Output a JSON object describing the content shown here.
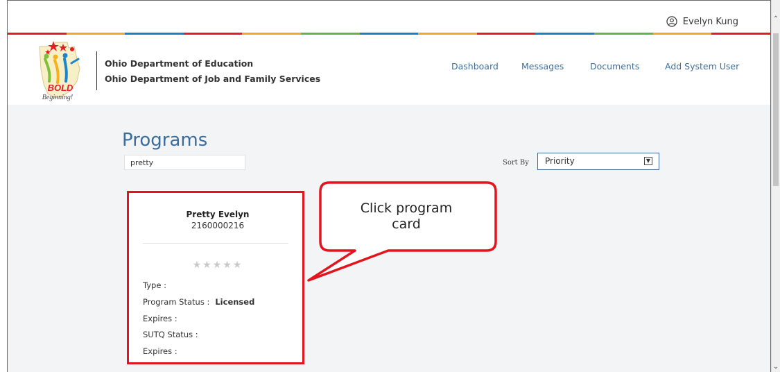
{
  "user": {
    "name": "Evelyn Kung",
    "icon": "user-circle-icon"
  },
  "stripe_colors": [
    "#e31b23",
    "#f5a623",
    "#1b7fc4",
    "#e31b23",
    "#f5a623",
    "#66b245",
    "#1b7fc4",
    "#f5a623",
    "#e31b23",
    "#1b7fc4",
    "#66b245",
    "#f5a623",
    "#e31b23"
  ],
  "brand": {
    "logo_text": "BOLD",
    "logo_subtext": "Beginning!",
    "org_line1": "Ohio Department of Education",
    "org_line2": "Ohio Department of Job and Family Services"
  },
  "nav": {
    "items": [
      {
        "label": "Dashboard"
      },
      {
        "label": "Messages"
      },
      {
        "label": "Documents"
      },
      {
        "label": "Add System User"
      }
    ]
  },
  "programs": {
    "title": "Programs",
    "search_value": "pretty",
    "sort_label": "Sort By",
    "sort_value": "Priority"
  },
  "card": {
    "name": "Pretty Evelyn",
    "id": "2160000216",
    "stars": "★★★★★",
    "rating": 0,
    "fields": {
      "type_label": "Type :",
      "status_label": "Program Status :",
      "status_value": "Licensed",
      "expires_label": "Expires :",
      "sutq_label": "SUTQ Status :",
      "sutq_expires_label": "Expires :"
    }
  },
  "callout": {
    "line1": "Click program",
    "line2": "card"
  },
  "accent_colors": {
    "link": "#3f6f9a",
    "title": "#3b6c99",
    "highlight": "#e3141e"
  }
}
